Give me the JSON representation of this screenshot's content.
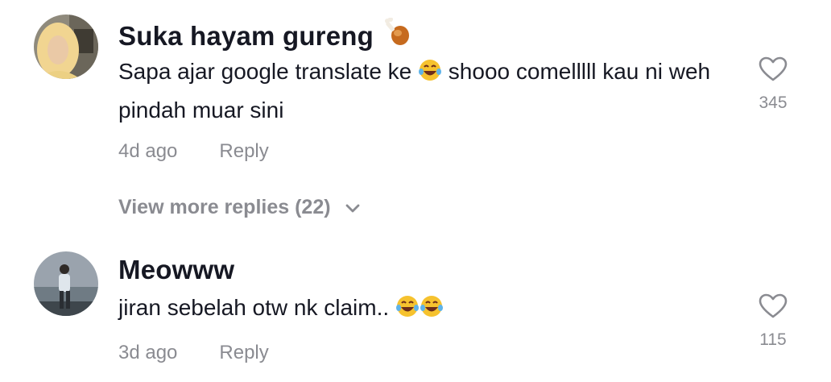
{
  "comments": [
    {
      "username": "Suka hayam gureng",
      "username_icon": "chicken-leg-icon",
      "text_before_emoji": "Sapa ajar google translate ke ",
      "emoji": "face-with-tears-of-joy-icon",
      "text_after_emoji": " shooo comelllll kau ni weh pindah muar sini",
      "time": "4d ago",
      "reply_label": "Reply",
      "likes": "345",
      "like_icon": "heart-outline-icon"
    },
    {
      "username": "Meowww",
      "text": "jiran sebelah otw nk claim.. ",
      "emoji": "face-with-tears-of-joy-icon",
      "emoji_count": 2,
      "time": "3d ago",
      "reply_label": "Reply",
      "likes": "115",
      "like_icon": "heart-outline-icon"
    }
  ],
  "view_more": {
    "label": "View more replies (22)",
    "icon": "chevron-down-icon"
  },
  "colors": {
    "text_primary": "#161823",
    "text_secondary": "#8a8b91"
  }
}
